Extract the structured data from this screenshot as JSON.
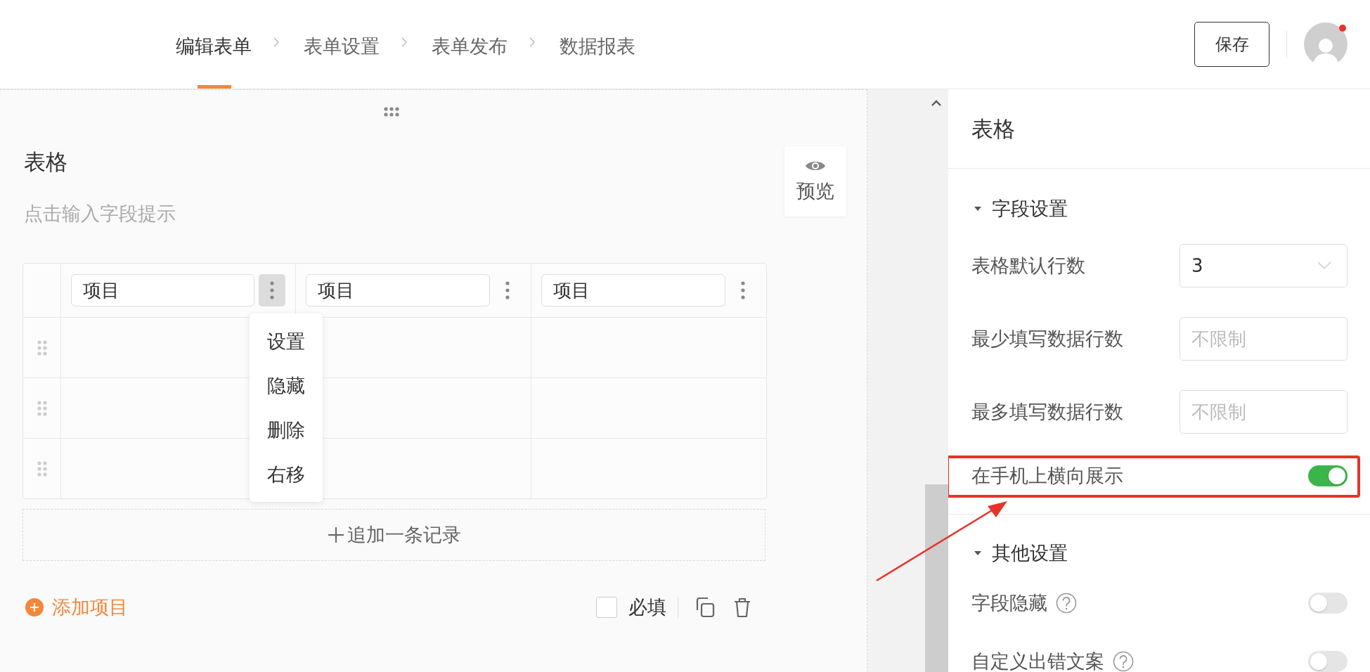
{
  "steps": [
    {
      "label": "编辑表单",
      "selected": true
    },
    {
      "label": "表单设置",
      "selected": false
    },
    {
      "label": "表单发布",
      "selected": false
    },
    {
      "label": "数据报表",
      "selected": false
    }
  ],
  "save_button": "保存",
  "avatar": {
    "has_notification": true
  },
  "canvas": {
    "title": "表格",
    "hint": "点击输入字段提示",
    "preview": "预览",
    "columns": [
      {
        "label": "项目",
        "menu_open": true
      },
      {
        "label": "项目",
        "menu_open": false
      },
      {
        "label": "项目",
        "menu_open": false
      }
    ],
    "column_menu": [
      "设置",
      "隐藏",
      "删除",
      "右移"
    ],
    "rows": [
      {
        "kind": "empty"
      },
      {
        "kind": "empty"
      },
      {
        "kind": "empty"
      }
    ],
    "add_record": "追加一条记录",
    "add_item": "添加项目",
    "required": {
      "label": "必填",
      "checked": false
    }
  },
  "panel": {
    "title": "表格",
    "sections": [
      {
        "title": "字段设置",
        "expanded": true,
        "fields": [
          {
            "kind": "select",
            "label": "表格默认行数",
            "value": "3"
          },
          {
            "kind": "input",
            "label": "最少填写数据行数",
            "placeholder": "不限制"
          },
          {
            "kind": "input",
            "label": "最多填写数据行数",
            "placeholder": "不限制"
          },
          {
            "kind": "toggle",
            "label": "在手机上横向展示",
            "on": true,
            "highlighted": true
          }
        ]
      },
      {
        "title": "其他设置",
        "expanded": true,
        "fields": [
          {
            "kind": "toggle",
            "label": "字段隐藏",
            "on": false,
            "help": true
          },
          {
            "kind": "toggle",
            "label": "自定义出错文案",
            "on": false,
            "help": true
          }
        ]
      }
    ]
  }
}
